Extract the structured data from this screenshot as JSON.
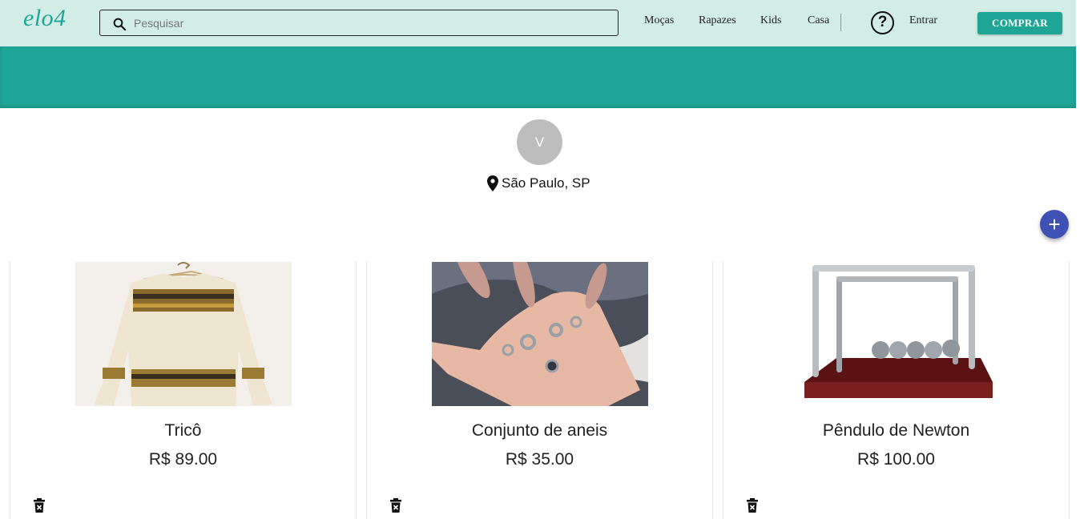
{
  "header": {
    "logo": "elo4",
    "search": {
      "placeholder": "Pesquisar",
      "value": ""
    },
    "nav": [
      "Moças",
      "Rapazes",
      "Kids",
      "Casa"
    ],
    "help_icon": "?",
    "login_label": "Entrar",
    "buy_label": "COMPRAR"
  },
  "profile": {
    "avatar_initial": "V",
    "location": "São Paulo, SP"
  },
  "add_button_label": "+",
  "products": [
    {
      "title": "Tricô",
      "price": "R$ 89.00"
    },
    {
      "title": "Conjunto de aneis",
      "price": "R$ 35.00"
    },
    {
      "title": "Pêndulo de Newton",
      "price": "R$ 100.00"
    }
  ],
  "colors": {
    "header_bg": "#d2ece6",
    "brand": "#1fa595",
    "fab": "#3f51b5",
    "avatar": "#bdbdbd"
  }
}
